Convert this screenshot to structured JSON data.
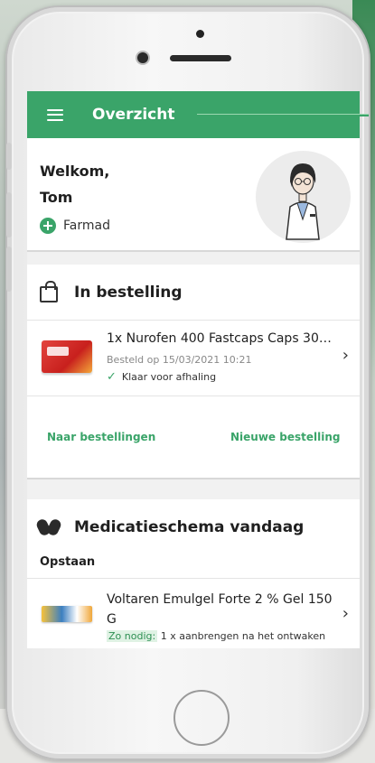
{
  "appbar": {
    "title": "Overzicht"
  },
  "welcome": {
    "greeting": "Welkom,",
    "user": "Tom",
    "pharmacy": "Farmad"
  },
  "orders": {
    "title": "In bestelling",
    "item": {
      "name": "1x Nurofen 400 Fastcaps Caps 30 ...",
      "date": "Besteld op 15/03/2021 10:21",
      "status": "Klaar voor afhaling"
    },
    "link_orders": "Naar bestellingen",
    "link_new": "Nieuwe bestelling"
  },
  "medication": {
    "title": "Medicatieschema vandaag",
    "moment": "Opstaan",
    "item": {
      "name": "Voltaren Emulgel Forte 2 % Gel 150 G",
      "tag": "Zo nodig:",
      "instruction": "1 x aanbrengen na het ontwaken"
    }
  },
  "colors": {
    "accent": "#3aa469",
    "tag_bg": "#dff2e4"
  },
  "icons": [
    "hamburger-menu-icon",
    "plus-icon",
    "shopping-bag-icon",
    "check-icon",
    "chevron-right-icon",
    "pills-icon"
  ]
}
